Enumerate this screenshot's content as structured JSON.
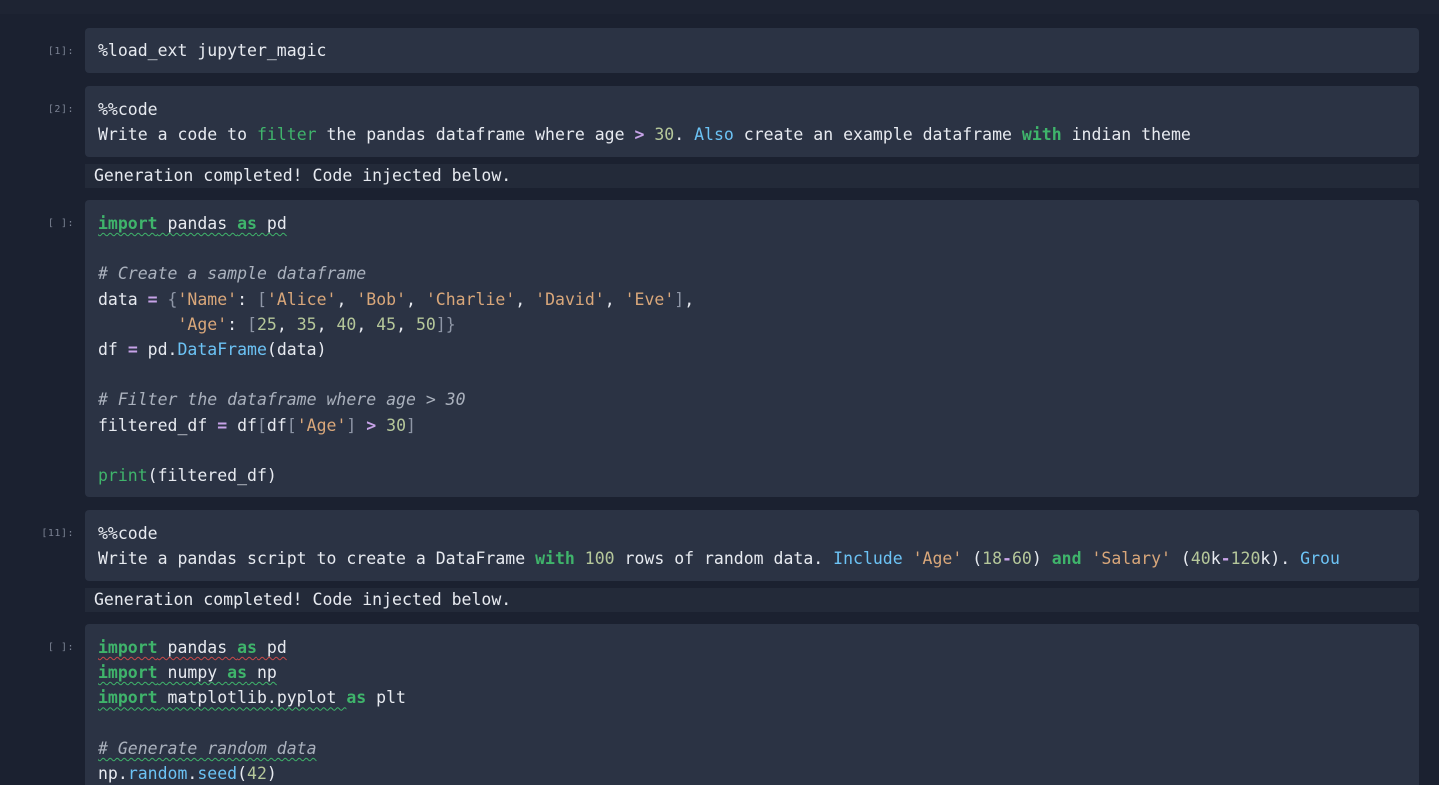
{
  "cells": [
    {
      "prompt": "[1]:",
      "lines": [
        [
          {
            "t": "%load_ext jupyter_magic",
            "c": ""
          }
        ]
      ]
    },
    {
      "prompt": "[2]:",
      "lines": [
        [
          {
            "t": "%%code",
            "c": ""
          }
        ],
        [
          {
            "t": "Write a code to ",
            "c": ""
          },
          {
            "t": "filter",
            "c": "hl-green"
          },
          {
            "t": " the pandas dataframe where age ",
            "c": ""
          },
          {
            "t": ">",
            "c": "op"
          },
          {
            "t": " ",
            "c": ""
          },
          {
            "t": "30",
            "c": "num"
          },
          {
            "t": ". ",
            "c": ""
          },
          {
            "t": "Also",
            "c": "hl-blue"
          },
          {
            "t": " create an example dataframe ",
            "c": ""
          },
          {
            "t": "with",
            "c": "kw"
          },
          {
            "t": " indian theme",
            "c": ""
          }
        ]
      ],
      "output": "Generation completed! Code injected below."
    },
    {
      "prompt": "[ ]:",
      "lines": [
        [
          {
            "t": "import",
            "c": "kw squig"
          },
          {
            "t": " pandas ",
            "c": "squig"
          },
          {
            "t": "as",
            "c": "kw squig"
          },
          {
            "t": " pd",
            "c": "squig"
          }
        ],
        [],
        [
          {
            "t": "# Create a sample dataframe",
            "c": "cm"
          }
        ],
        [
          {
            "t": "data ",
            "c": ""
          },
          {
            "t": "=",
            "c": "op"
          },
          {
            "t": " ",
            "c": ""
          },
          {
            "t": "{",
            "c": "br"
          },
          {
            "t": "'Name'",
            "c": "str"
          },
          {
            "t": ": ",
            "c": ""
          },
          {
            "t": "[",
            "c": "br"
          },
          {
            "t": "'Alice'",
            "c": "str"
          },
          {
            "t": ", ",
            "c": ""
          },
          {
            "t": "'Bob'",
            "c": "str"
          },
          {
            "t": ", ",
            "c": ""
          },
          {
            "t": "'Charlie'",
            "c": "str"
          },
          {
            "t": ", ",
            "c": ""
          },
          {
            "t": "'David'",
            "c": "str"
          },
          {
            "t": ", ",
            "c": ""
          },
          {
            "t": "'Eve'",
            "c": "str"
          },
          {
            "t": "]",
            "c": "br"
          },
          {
            "t": ",",
            "c": ""
          }
        ],
        [
          {
            "t": "        ",
            "c": ""
          },
          {
            "t": "'Age'",
            "c": "str"
          },
          {
            "t": ": ",
            "c": ""
          },
          {
            "t": "[",
            "c": "br"
          },
          {
            "t": "25",
            "c": "num"
          },
          {
            "t": ", ",
            "c": ""
          },
          {
            "t": "35",
            "c": "num"
          },
          {
            "t": ", ",
            "c": ""
          },
          {
            "t": "40",
            "c": "num"
          },
          {
            "t": ", ",
            "c": ""
          },
          {
            "t": "45",
            "c": "num"
          },
          {
            "t": ", ",
            "c": ""
          },
          {
            "t": "50",
            "c": "num"
          },
          {
            "t": "]}",
            "c": "br"
          }
        ],
        [
          {
            "t": "df ",
            "c": ""
          },
          {
            "t": "=",
            "c": "op"
          },
          {
            "t": " pd.",
            "c": ""
          },
          {
            "t": "DataFrame",
            "c": "cls"
          },
          {
            "t": "(data)",
            "c": ""
          }
        ],
        [],
        [
          {
            "t": "# Filter the dataframe where age > 30",
            "c": "cm"
          }
        ],
        [
          {
            "t": "filtered_df ",
            "c": ""
          },
          {
            "t": "=",
            "c": "op"
          },
          {
            "t": " df",
            "c": ""
          },
          {
            "t": "[",
            "c": "br"
          },
          {
            "t": "df",
            "c": ""
          },
          {
            "t": "[",
            "c": "br"
          },
          {
            "t": "'Age'",
            "c": "str"
          },
          {
            "t": "]",
            "c": "br"
          },
          {
            "t": " ",
            "c": ""
          },
          {
            "t": ">",
            "c": "op"
          },
          {
            "t": " ",
            "c": ""
          },
          {
            "t": "30",
            "c": "num"
          },
          {
            "t": "]",
            "c": "br"
          }
        ],
        [],
        [
          {
            "t": "print",
            "c": "fn"
          },
          {
            "t": "(filtered_df)",
            "c": ""
          }
        ]
      ]
    },
    {
      "prompt": "[11]:",
      "lines": [
        [
          {
            "t": "%%code",
            "c": ""
          }
        ],
        [
          {
            "t": "Write a pandas script to create a DataFrame ",
            "c": ""
          },
          {
            "t": "with",
            "c": "kw"
          },
          {
            "t": " ",
            "c": ""
          },
          {
            "t": "100",
            "c": "num"
          },
          {
            "t": " rows of random data. ",
            "c": ""
          },
          {
            "t": "Include",
            "c": "hl-blue"
          },
          {
            "t": " ",
            "c": ""
          },
          {
            "t": "'Age'",
            "c": "str"
          },
          {
            "t": " (",
            "c": ""
          },
          {
            "t": "18",
            "c": "num"
          },
          {
            "t": "-",
            "c": "op"
          },
          {
            "t": "60",
            "c": "num"
          },
          {
            "t": ") ",
            "c": ""
          },
          {
            "t": "and",
            "c": "kw"
          },
          {
            "t": " ",
            "c": ""
          },
          {
            "t": "'Salary'",
            "c": "str"
          },
          {
            "t": " (",
            "c": ""
          },
          {
            "t": "40",
            "c": "num"
          },
          {
            "t": "k",
            "c": ""
          },
          {
            "t": "-",
            "c": "op"
          },
          {
            "t": "120",
            "c": "num"
          },
          {
            "t": "k). ",
            "c": ""
          },
          {
            "t": "Grou",
            "c": "hl-blue"
          }
        ]
      ],
      "output": "Generation completed! Code injected below."
    },
    {
      "prompt": "[ ]:",
      "lines": [
        [
          {
            "t": "import",
            "c": "kw squig-red"
          },
          {
            "t": " pandas ",
            "c": "squig-red"
          },
          {
            "t": "as",
            "c": "kw squig-red"
          },
          {
            "t": " pd",
            "c": "squig-red"
          }
        ],
        [
          {
            "t": "import",
            "c": "kw squig"
          },
          {
            "t": " numpy ",
            "c": "squig"
          },
          {
            "t": "as",
            "c": "kw squig"
          },
          {
            "t": " np",
            "c": "squig"
          }
        ],
        [
          {
            "t": "import",
            "c": "kw squig"
          },
          {
            "t": " matplotlib.pyplot ",
            "c": "squig"
          },
          {
            "t": "as",
            "c": "kw"
          },
          {
            "t": " plt",
            "c": ""
          }
        ],
        [],
        [
          {
            "t": "# Generate random data",
            "c": "cm squig"
          }
        ],
        [
          {
            "t": "np.",
            "c": ""
          },
          {
            "t": "random",
            "c": "cls"
          },
          {
            "t": ".",
            "c": ""
          },
          {
            "t": "seed",
            "c": "cls"
          },
          {
            "t": "(",
            "c": ""
          },
          {
            "t": "42",
            "c": "num"
          },
          {
            "t": ")",
            "c": ""
          }
        ]
      ]
    }
  ]
}
